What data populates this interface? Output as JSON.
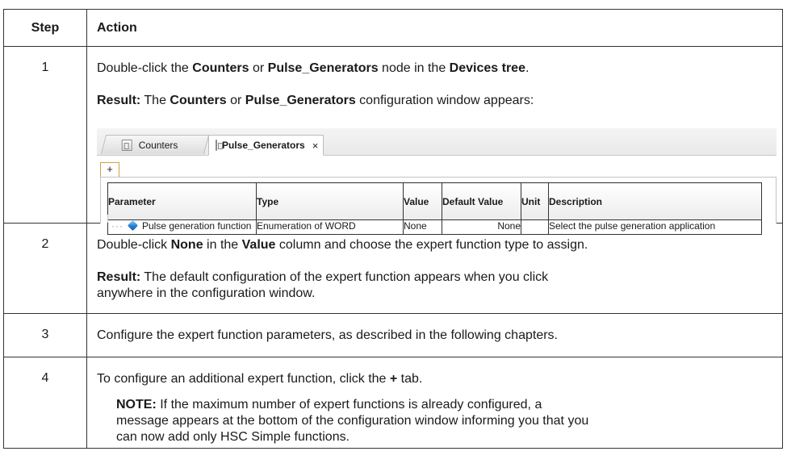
{
  "table": {
    "header": {
      "step": "Step",
      "action": "Action"
    },
    "rows": [
      {
        "step": "1",
        "line1": {
          "t1": "Double-click the ",
          "b1": "Counters",
          "t2": " or ",
          "b2": "Pulse_Generators",
          "t3": " node in the ",
          "b3": "Devices tree",
          "t4": "."
        },
        "line2": {
          "b1": "Result:",
          "t1": " The ",
          "b2": "Counters",
          "t2": " or ",
          "b3": "Pulse_Generators",
          "t3": " configuration window appears:"
        }
      },
      {
        "step": "2",
        "line1": {
          "t1": "Double-click ",
          "b1": "None",
          "t2": " in the ",
          "b2": "Value",
          "t3": " column and choose the expert function type to assign."
        },
        "line2": {
          "b1": "Result:",
          "t1": " The default configuration of the expert function appears when you click",
          "t2": "anywhere in the configuration window."
        }
      },
      {
        "step": "3",
        "line1": {
          "t1": "Configure the expert function parameters, as described in the following chapters."
        }
      },
      {
        "step": "4",
        "line1": {
          "t1": "To configure an additional expert function, click the ",
          "b1": "+",
          "t2": " tab."
        },
        "note": {
          "b1": "NOTE:",
          "t1": " If the maximum number of expert functions is already configured, a",
          "t2": "message appears at the bottom of the configuration window informing you that you",
          "t3": "can now add only HSC Simple functions."
        }
      }
    ]
  },
  "config_window": {
    "tabs": [
      {
        "label": "Counters",
        "active": false
      },
      {
        "label": "Pulse_Generators",
        "active": true,
        "close": "×"
      }
    ],
    "add_tab": "+",
    "columns": [
      "Parameter",
      "Type",
      "Value",
      "Default Value",
      "Unit",
      "Description"
    ],
    "rows": [
      {
        "tree": "···",
        "parameter": "Pulse generation function",
        "type": "Enumeration of WORD",
        "value": "None",
        "default_value": "None",
        "unit": "",
        "description": "Select the pulse generation application"
      }
    ]
  }
}
